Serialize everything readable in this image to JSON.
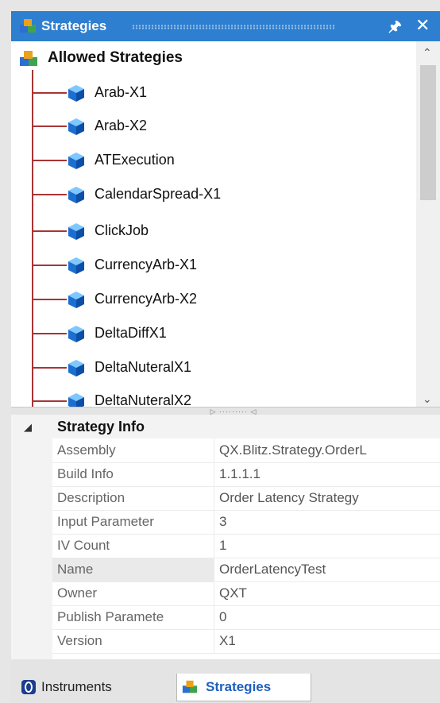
{
  "panel": {
    "title": "Strategies",
    "pin_icon": "pin-icon",
    "close_icon": "close-icon"
  },
  "tree": {
    "root_label": "Allowed Strategies",
    "items": [
      {
        "label": "Arab-X1"
      },
      {
        "label": "Arab-X2"
      },
      {
        "label": "ATExecution"
      },
      {
        "label": "CalendarSpread-X1"
      },
      {
        "label": "ClickJob"
      },
      {
        "label": "CurrencyArb-X1"
      },
      {
        "label": "CurrencyArb-X2"
      },
      {
        "label": "DeltaDiffX1"
      },
      {
        "label": "DeltaNuteralX1"
      },
      {
        "label": "DeltaNuteralX2"
      }
    ]
  },
  "properties": {
    "category": "Strategy Info",
    "rows": [
      {
        "name": "Assembly",
        "value": "QX.Blitz.Strategy.OrderL"
      },
      {
        "name": "Build Info",
        "value": "1.1.1.1"
      },
      {
        "name": "Description",
        "value": "Order Latency Strategy"
      },
      {
        "name": "Input Parameter",
        "value": "3"
      },
      {
        "name": "IV Count",
        "value": "1"
      },
      {
        "name": "Name",
        "value": "OrderLatencyTest"
      },
      {
        "name": "Owner",
        "value": "QXT"
      },
      {
        "name": "Publish Paramete",
        "value": "0"
      },
      {
        "name": "Version",
        "value": "X1"
      }
    ]
  },
  "tabs": [
    {
      "label": "Instruments",
      "icon": "instruments-icon"
    },
    {
      "label": "Strategies",
      "icon": "strategies-icon",
      "active": true
    }
  ],
  "colors": {
    "titlebar": "#2e7fd0",
    "tree_line": "#a83434",
    "active_tab_text": "#1f5fbf"
  }
}
